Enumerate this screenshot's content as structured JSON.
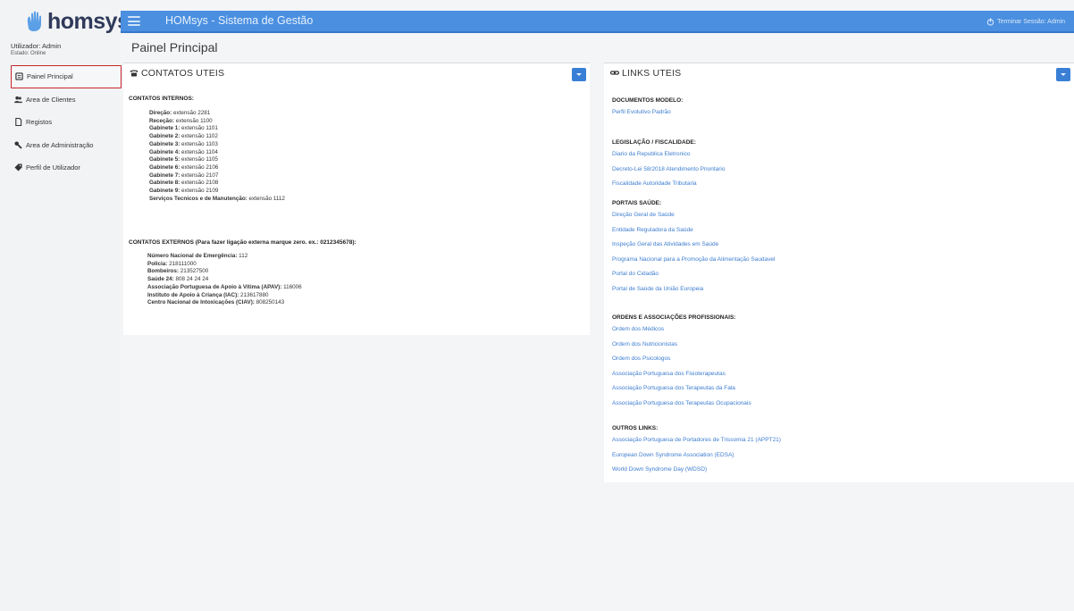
{
  "brand": {
    "logo_text": "homsys"
  },
  "user": {
    "name": "Utilizador: Admin",
    "status": "Estado: Online"
  },
  "sidebar": {
    "items": [
      {
        "label": "Painel Principal",
        "icon": "dashboard-icon",
        "active": true
      },
      {
        "label": "Area de Clientes",
        "icon": "users-icon",
        "active": false
      },
      {
        "label": "Registos",
        "icon": "file-icon",
        "active": false
      },
      {
        "label": "Area de Administração",
        "icon": "wrench-icon",
        "active": false
      },
      {
        "label": "Perfil de Utilizador",
        "icon": "tag-icon",
        "active": false
      }
    ]
  },
  "topbar": {
    "title": "HOMsys - Sistema de Gestão",
    "logout_label": "Terminar Sessão: Admin"
  },
  "page": {
    "title": "Painel Principal"
  },
  "contacts_panel": {
    "title": "CONTATOS UTEIS",
    "internal_label": "CONTATOS INTERNOS:",
    "internal": [
      {
        "name": "Direção:",
        "value": "extensão 2281"
      },
      {
        "name": "Receção:",
        "value": "extensão 1100"
      },
      {
        "name": "Gabinete 1:",
        "value": "extensão 1101"
      },
      {
        "name": "Gabinete 2:",
        "value": "extensão 1102"
      },
      {
        "name": "Gabinete 3:",
        "value": "extensão 1103"
      },
      {
        "name": "Gabinete 4:",
        "value": "extensão 1104"
      },
      {
        "name": "Gabinete 5:",
        "value": "extensão 1105"
      },
      {
        "name": "Gabinete 6:",
        "value": "extensão 2106"
      },
      {
        "name": "Gabinete 7:",
        "value": "extensão 2107"
      },
      {
        "name": "Gabinete 8:",
        "value": "extensão 2108"
      },
      {
        "name": "Gabinete 9:",
        "value": "extensão 2109"
      },
      {
        "name": "Serviços Tecnicos e de Manutenção:",
        "value": "extensão 1112"
      }
    ],
    "external_label": "CONTATOS EXTERNOS (Para fazer ligação externa marque zero. ex.: 0212345678):",
    "external": [
      {
        "name": "Número Nacional de Emergência:",
        "value": "112"
      },
      {
        "name": "Policia:",
        "value": "218111000"
      },
      {
        "name": "Bombeiros:",
        "value": "213527500"
      },
      {
        "name": "Saúde 24:",
        "value": "808 24 24 24"
      },
      {
        "name": "Associação Portuguesa de Apoio à Vítima (APAV):",
        "value": "116006"
      },
      {
        "name": "Instituto de Apoio à Criança (IAC):",
        "value": "213617880"
      },
      {
        "name": "Centro Nacional de Intoxicações (CIAV):",
        "value": "808250143"
      }
    ]
  },
  "links_panel": {
    "title": "LINKS UTEIS",
    "groups": [
      {
        "label": "DOCUMENTOS MODELO:",
        "links": [
          "Perfil Evolutivo Padrão"
        ]
      },
      {
        "label": "LEGISLAÇÃO / FISCALIDADE:",
        "links": [
          "Diario da Republica Eletronico",
          "Decreto-Lei 58/2018 Atendimento Prioritario",
          "Fiscalidade Autoridade Tributaria"
        ]
      },
      {
        "label": "PORTAIS SAÚDE:",
        "links": [
          "Direção Geral de Saúde",
          "Entidade Reguladora da Saúde",
          "Inspeção Geral das Atividades em Saúde",
          "Programa Nacional para a Promoção da Alimentação Saudavel",
          "Portal do Cidadão",
          "Portal de Saúde da União Europeia"
        ]
      },
      {
        "label": "ORDENS E ASSOCIAÇÕES PROFISSIONAIS:",
        "links": [
          "Ordem dos Médicos",
          "Ordem dos Nutricionistas",
          "Ordem dos Psicologos",
          "Associação Portuguesa dos Fisioterapeutas",
          "Associação Portuguesa dos Terapeutas da Fala",
          "Associação Portuguesa dos Terapeutas Ocupacionais"
        ]
      },
      {
        "label": "OUTROS LINKS:",
        "links": [
          "Associação Portuguesa de Portadores de Trissomia 21 (APPT21)",
          "European Down Syndrome Association (EDSA)",
          "World Down Syndrome Day (WDSD)"
        ]
      }
    ]
  },
  "colors": {
    "topbar": "#4a8fe0",
    "accent_button": "#3a7fd6",
    "link": "#3d7dd0",
    "active_border": "#c8242c",
    "brand_text": "#2f3a5a"
  }
}
